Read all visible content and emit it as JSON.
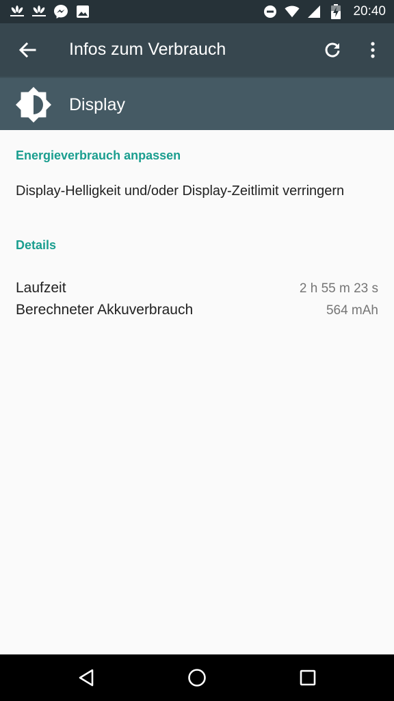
{
  "status_bar": {
    "time": "20:40",
    "left_icons": [
      "huawei-icon",
      "huawei-icon",
      "messenger-icon",
      "gallery-icon"
    ],
    "right_icons": [
      "do-not-disturb-icon",
      "wifi-icon",
      "signal-icon",
      "battery-charging-icon"
    ]
  },
  "toolbar": {
    "title": "Infos zum Verbrauch",
    "back_icon": "arrow-back-icon",
    "refresh_icon": "refresh-icon",
    "more_icon": "more-vert-icon"
  },
  "header": {
    "title": "Display",
    "icon": "brightness-icon"
  },
  "sections": {
    "adjust": {
      "heading": "Energieverbrauch anpassen",
      "text": "Display-Helligkeit und/oder Display-Zeitlimit verringern"
    },
    "details": {
      "heading": "Details",
      "rows": [
        {
          "label": "Laufzeit",
          "value": "2 h 55 m 23 s"
        },
        {
          "label": "Berechneter Akkuverbrauch",
          "value": "564 mAh"
        }
      ]
    }
  },
  "colors": {
    "status_bar": "#263238",
    "toolbar": "#37474f",
    "header": "#455a64",
    "accent": "#1a9e8f",
    "background": "#fafafa"
  },
  "navbar": {
    "icons": [
      "back-triangle-icon",
      "home-circle-icon",
      "recents-square-icon"
    ]
  }
}
